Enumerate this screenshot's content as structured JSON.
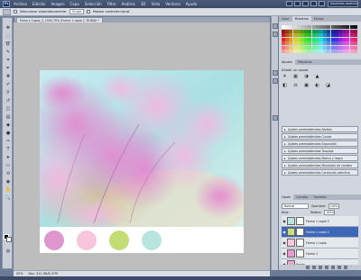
{
  "menubar": {
    "logo": "Ps",
    "items": [
      "Archivo",
      "Edición",
      "Imagen",
      "Capa",
      "Selección",
      "Filtro",
      "Análisis",
      "3D",
      "Vista",
      "Ventana",
      "Ayuda"
    ],
    "workspace": "Aspectos esenciales"
  },
  "options": {
    "auto_select_label": "Seleccionar automáticamente:",
    "auto_select_value": "Grupo",
    "transform_label": "Mostrar controles transf."
  },
  "document_tab": "Pomo y Capas_0_1000.70% (Forma 1 copia 2, RGB/8) *",
  "status": {
    "zoom": "50%",
    "doc_size": "Doc: 411,9K/6,37M"
  },
  "panels": {
    "top_tabs": [
      "Color",
      "Muestras",
      "Estilos"
    ],
    "adjust_tabs": [
      "Ajustes",
      "Máscaras"
    ],
    "adjust_title": "Añadir un ajuste",
    "adjust_icons": [
      "☀",
      "▦",
      "◑",
      "▲",
      "◧",
      "⚖",
      "▣",
      "◐",
      "◪",
      "▤",
      "◫",
      "▥"
    ],
    "presets": [
      "Ajustes preestablecidos Niveles",
      "Ajustes preestablecidos Curvas",
      "Ajustes preestablecidos Exposición",
      "Ajustes preestablecidos Tono/sat.",
      "Ajustes preestablecidos Blanco y negro",
      "Ajustes preestablecidos Mezclador de canales",
      "Ajustes preestablecidos Corrección selectiva"
    ],
    "layer_tabs": [
      "Capas",
      "Canales",
      "Trazados"
    ],
    "blend_mode": "Normal",
    "opacity_label": "Opacidad:",
    "opacity_value": "100%",
    "lock_label": "Bloq.:",
    "fill_label": "Relleno:",
    "fill_value": "100%",
    "layers": [
      {
        "name": "Forma 1 copia 3",
        "color": "#b8e4de",
        "selected": false
      },
      {
        "name": "Forma 1 copia 2",
        "color": "#c9e07a",
        "selected": true
      },
      {
        "name": "Forma 1 copia",
        "color": "#f7c7dc",
        "selected": false
      },
      {
        "name": "Forma 1",
        "color": "#e79ad0",
        "selected": false
      },
      {
        "name": "Fondo",
        "color": "#e6a6cf",
        "selected": false
      }
    ]
  },
  "palette_circles": [
    "#df96cf",
    "#f7c5dc",
    "#c3dd75",
    "#b8e5df"
  ]
}
